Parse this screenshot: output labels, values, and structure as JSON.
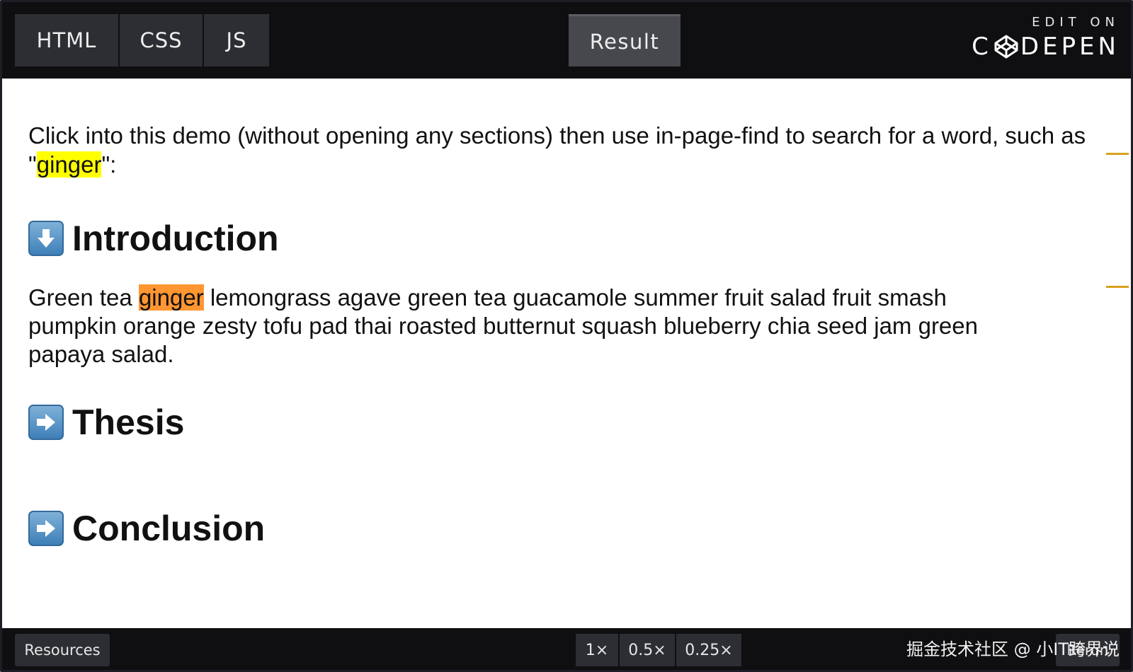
{
  "topbar": {
    "tabs": [
      {
        "label": "HTML"
      },
      {
        "label": "CSS"
      },
      {
        "label": "JS"
      }
    ],
    "result_label": "Result",
    "codepen": {
      "edit_on": "EDIT ON",
      "brand_left": "C",
      "brand_right": "DEPEN"
    }
  },
  "content": {
    "instruction_before": "Click into this demo (without opening any sections) then use in-page-find to search for a word, such as \"",
    "instruction_highlight": "ginger",
    "instruction_after": "\":",
    "sections": [
      {
        "title": "Introduction",
        "icon": "down-arrow-icon"
      },
      {
        "title": "Thesis",
        "icon": "right-arrow-icon"
      },
      {
        "title": "Conclusion",
        "icon": "right-arrow-icon"
      }
    ],
    "intro_body_before": "Green tea ",
    "intro_body_highlight": "ginger",
    "intro_body_after": " lemongrass agave green tea guacamole summer fruit salad fruit smash pumpkin orange zesty tofu pad thai roasted butternut squash blueberry chia seed jam green papaya salad."
  },
  "bottombar": {
    "resources_label": "Resources",
    "zoom_options": [
      "1×",
      "0.5×",
      "0.25×"
    ],
    "rerun_label": "Rerun",
    "watermark": "掘金技术社区 @ 小IT跨界说"
  },
  "colors": {
    "find_match": "#ffff00",
    "find_current": "#ff9632",
    "bar_bg": "#0f0f11",
    "button_bg": "#2d2e33"
  }
}
